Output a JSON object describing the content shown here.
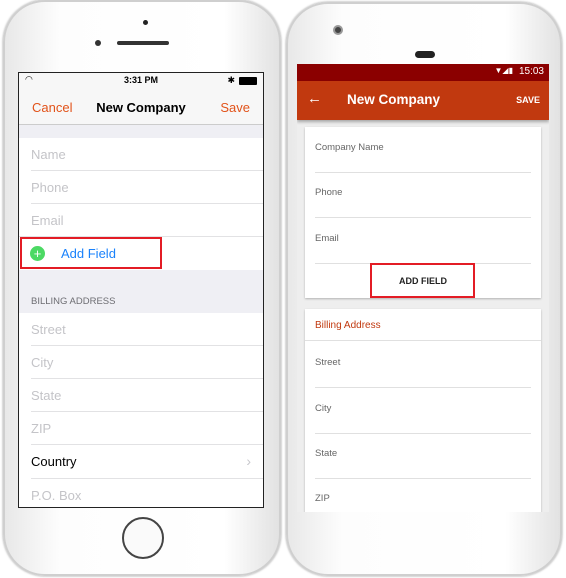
{
  "ios": {
    "status": {
      "time": "3:31 PM"
    },
    "nav": {
      "cancel": "Cancel",
      "title": "New Company",
      "save": "Save"
    },
    "fields": [
      "Name",
      "Phone",
      "Email"
    ],
    "add_field": "Add Field",
    "billing_header": "BILLING ADDRESS",
    "billing_fields": [
      "Street",
      "City",
      "State",
      "ZIP"
    ],
    "country": "Country",
    "po_box": "P.O. Box",
    "accent": "#e2531a",
    "link": "#1a82fb"
  },
  "android": {
    "status": {
      "time": "15:03"
    },
    "toolbar": {
      "title": "New Company",
      "save": "SAVE"
    },
    "fields": [
      "Company Name",
      "Phone",
      "Email"
    ],
    "add_field": "ADD FIELD",
    "billing_header": "Billing Address",
    "billing_fields": [
      "Street",
      "City",
      "State",
      "ZIP"
    ],
    "primary": "#c1390f",
    "primary_dark": "#8b0000"
  }
}
